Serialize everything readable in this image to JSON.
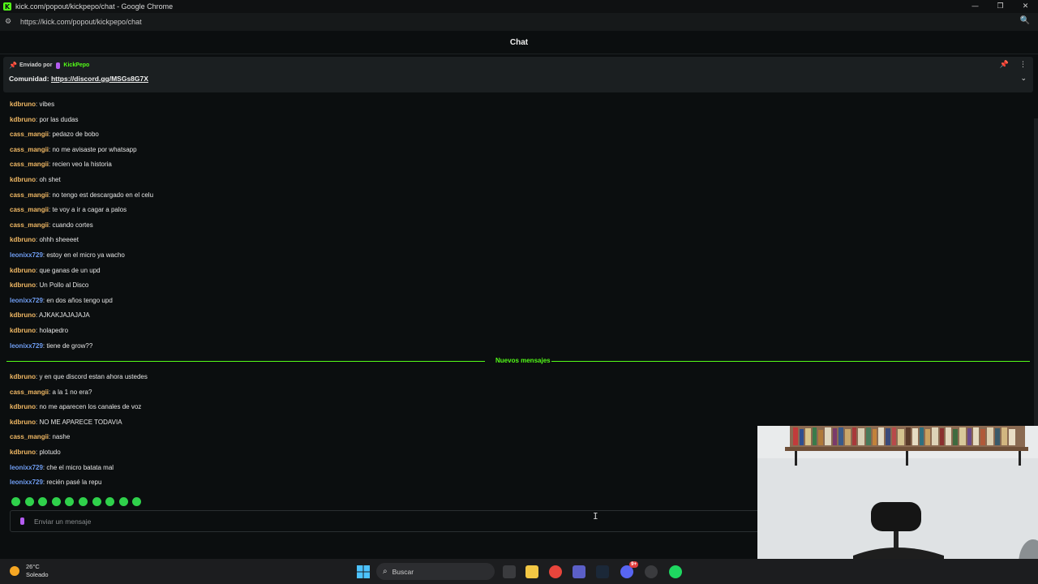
{
  "window": {
    "title": "kick.com/popout/kickpepo/chat - Google Chrome",
    "url": "https://kick.com/popout/kickpepo/chat",
    "favicon": "K"
  },
  "chat": {
    "header": "Chat",
    "pinned": {
      "sent_by_label": "Enviado por",
      "author": "KickPepo",
      "text_prefix": "Comunidad:",
      "link": "https://discord.gg/MSGs8G7X"
    },
    "messages": [
      {
        "user": "kdbruno",
        "text": ": vibes"
      },
      {
        "user": "kdbruno",
        "text": ": por las dudas"
      },
      {
        "user": "cass_mangii",
        "text": ": pedazo de bobo"
      },
      {
        "user": "cass_mangii",
        "text": ": no me avisaste por whatsapp"
      },
      {
        "user": "cass_mangii",
        "text": ": recien veo la historia"
      },
      {
        "user": "kdbruno",
        "text": ": oh shet"
      },
      {
        "user": "cass_mangii",
        "text": ": no tengo est descargado en el celu"
      },
      {
        "user": "cass_mangii",
        "text": ": te voy a ir a cagar a palos"
      },
      {
        "user": "cass_mangii",
        "text": ": cuando cortes"
      },
      {
        "user": "kdbruno",
        "text": ": ohhh sheeeet"
      },
      {
        "user": "leonixx729",
        "text": ": estoy en el micro ya wacho"
      },
      {
        "user": "kdbruno",
        "text": ": que ganas de un upd"
      },
      {
        "user": "kdbruno",
        "text": ": Un Pollo al Disco"
      },
      {
        "user": "leonixx729",
        "text": ": en dos años tengo upd"
      },
      {
        "user": "kdbruno",
        "text": ": AJKAKJAJAJAJA"
      },
      {
        "user": "kdbruno",
        "text": ": holapedro"
      },
      {
        "user": "leonixx729",
        "text": ": tiene de grow??"
      }
    ],
    "new_messages_label": "Nuevos mensajes",
    "new_messages": [
      {
        "user": "kdbruno",
        "text": ": y en que discord estan ahora ustedes"
      },
      {
        "user": "cass_mangii",
        "text": ": a la 1 no era?"
      },
      {
        "user": "kdbruno",
        "text": ": no me aparecen los canales de voz"
      },
      {
        "user": "kdbruno",
        "text": ": NO ME APARECE TODAVIA"
      },
      {
        "user": "cass_mangii",
        "text": ": nashe"
      },
      {
        "user": "kdbruno",
        "text": ": plotudo"
      },
      {
        "user": "leonixx729",
        "text": ": che el micro batata mal"
      },
      {
        "user": "leonixx729",
        "text": ": recién pasé la repu"
      }
    ],
    "input_placeholder": "Enviar un mensaje"
  },
  "taskbar": {
    "temperature": "26°C",
    "weather": "Soleado",
    "search_label": "Buscar",
    "discord_badge": "9+"
  },
  "colors": {
    "accent": "#53fc18",
    "user_orange": "#f0b864",
    "user_blue": "#6f9df2",
    "background": "#0b0e0f"
  }
}
